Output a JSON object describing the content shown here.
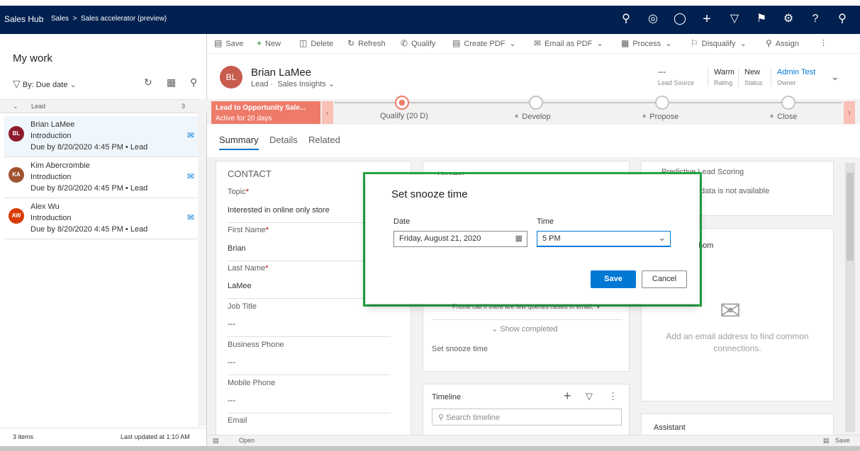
{
  "topbar": {
    "app": "Sales Hub",
    "crumb_area": "Sales",
    "crumb_sep": ">",
    "crumb_page": "Sales accelerator (preview)",
    "icons": [
      "search-icon",
      "target-icon",
      "lightbulb-icon",
      "plus-icon",
      "filter-icon",
      "assistant-icon",
      "gear-icon",
      "help-icon",
      "user-icon"
    ]
  },
  "leftpane": {
    "title": "My work",
    "sort_label": "By: Due date",
    "group_label": "Lead",
    "group_count": "3",
    "items": [
      {
        "initials": "BL",
        "name": "Brian LaMee",
        "subject": "Introduction",
        "due": "Due by 8/20/2020 4:45 PM • Lead",
        "color": "#8e1b2c"
      },
      {
        "initials": "KA",
        "name": "Kim Abercrombie",
        "subject": "Introduction",
        "due": "Due by 8/20/2020 4:45 PM • Lead",
        "color": "#a0522d"
      },
      {
        "initials": "AW",
        "name": "Alex Wu",
        "subject": "Introduction",
        "due": "Due by 8/20/2020 4:45 PM • Lead",
        "color": "#d83b01"
      }
    ],
    "footer_count": "3 items",
    "footer_updated": "Last updated at 1:10 AM"
  },
  "commandbar": {
    "save": "Save",
    "new": "New",
    "delete": "Delete",
    "refresh": "Refresh",
    "qualify": "Qualify",
    "create_pdf": "Create PDF",
    "email_pdf": "Email as PDF",
    "process": "Process",
    "disqualify": "Disqualify",
    "assign": "Assign"
  },
  "header": {
    "initials": "BL",
    "name": "Brian LaMee",
    "entity": "Lead",
    "form": "Sales Insights",
    "fields": [
      {
        "value": "---",
        "label": "Lead Source"
      },
      {
        "value": "Warm",
        "label": "Rating"
      },
      {
        "value": "New",
        "label": "Status"
      },
      {
        "value": "Admin Test",
        "label": "Owner"
      }
    ]
  },
  "bpf": {
    "process_name": "Lead to Opportunity Sale...",
    "active": "Active for 20 days",
    "stages": [
      "Qualify  (20 D)",
      "Develop",
      "Propose",
      "Close"
    ]
  },
  "tabs": [
    "Summary",
    "Details",
    "Related"
  ],
  "contact": {
    "title": "CONTACT",
    "fields": [
      {
        "label": "Topic",
        "value": "Interested in online only store",
        "required": "*"
      },
      {
        "label": "First Name",
        "value": "Brian",
        "required": "*"
      },
      {
        "label": "Last Name",
        "value": "LaMee",
        "required": "*"
      },
      {
        "label": "Job Title",
        "value": "---",
        "required": ""
      },
      {
        "label": "Business Phone",
        "value": "---",
        "required": ""
      },
      {
        "label": "Mobile Phone",
        "value": "---",
        "required": ""
      },
      {
        "label": "Email",
        "value": "",
        "required": ""
      }
    ]
  },
  "middle": {
    "up_next": "Up next",
    "activity_text": "Phone call if there are few queries raised in email.",
    "show_completed": "Show completed",
    "snooze_text": "Set snooze time",
    "timeline_title": "Timeline",
    "timeline_placeholder": "Search timeline"
  },
  "right": {
    "pls_title": "Predictive Lead Scoring",
    "pls_text": "data is not available",
    "who_title": "hom",
    "who_text": "Add an email address to find common connections.",
    "assistant": "Assistant"
  },
  "dialog": {
    "title": "Set snooze time",
    "date_label": "Date",
    "date_value": "Friday, August 21, 2020",
    "time_label": "Time",
    "time_value": "5 PM",
    "save": "Save",
    "cancel": "Cancel"
  },
  "statusbar": {
    "open": "Open",
    "save": "Save"
  }
}
